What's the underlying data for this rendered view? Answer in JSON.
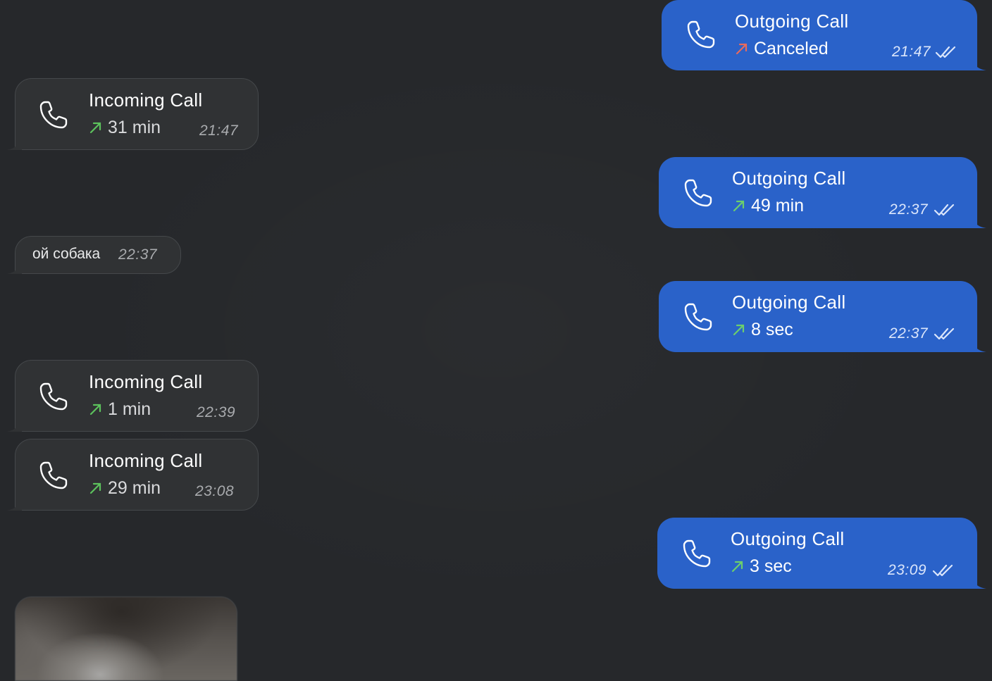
{
  "messages": [
    {
      "id": "out1",
      "title": "Outgoing Call",
      "status": "Canceled",
      "time": "21:47",
      "arrow_color": "#e86a5c"
    },
    {
      "id": "in1",
      "title": "Incoming Call",
      "status": "31 min",
      "time": "21:47",
      "arrow_color": "#5cc25c"
    },
    {
      "id": "out2",
      "title": "Outgoing Call",
      "status": "49 min",
      "time": "22:37",
      "arrow_color": "#6ccf6c"
    },
    {
      "id": "text1",
      "text": "ой собака",
      "time": "22:37"
    },
    {
      "id": "out3",
      "title": "Outgoing Call",
      "status": "8 sec",
      "time": "22:37",
      "arrow_color": "#6ccf6c"
    },
    {
      "id": "in2",
      "title": "Incoming Call",
      "status": "1 min",
      "time": "22:39",
      "arrow_color": "#5cc25c"
    },
    {
      "id": "in3",
      "title": "Incoming Call",
      "status": "29 min",
      "time": "23:08",
      "arrow_color": "#5cc25c"
    },
    {
      "id": "out4",
      "title": "Outgoing Call",
      "status": "3 sec",
      "time": "23:09",
      "arrow_color": "#6ccf6c"
    }
  ],
  "colors": {
    "background": "#26282b",
    "incoming_bubble": "#303234",
    "outgoing_bubble": "#2a62c9",
    "canceled_arrow": "#e86a5c",
    "success_arrow": "#5cc25c"
  },
  "icons": {
    "call": "phone-icon",
    "arrow": "arrow-up-right-icon",
    "read": "double-check-icon"
  }
}
